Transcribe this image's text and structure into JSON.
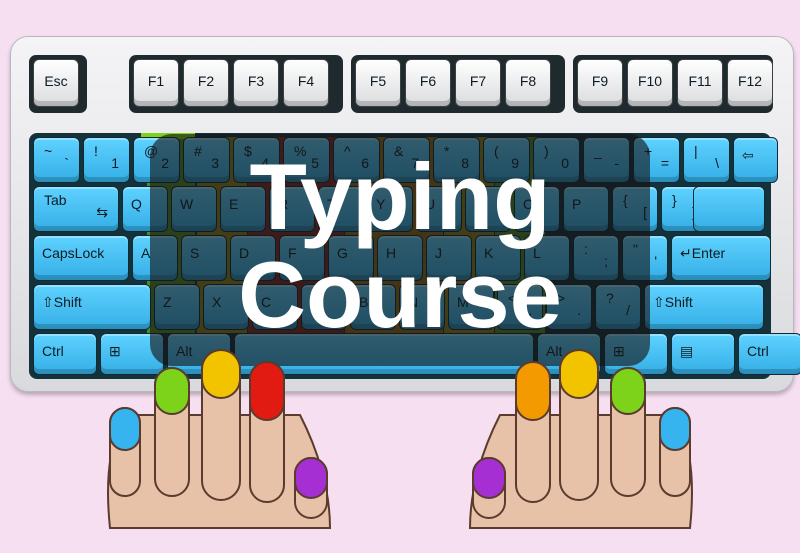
{
  "function_keys": [
    "Esc",
    "F1",
    "F2",
    "F3",
    "F4",
    "F5",
    "F6",
    "F7",
    "F8",
    "F9",
    "F10",
    "F11",
    "F12"
  ],
  "row1": [
    {
      "top": "~",
      "bottom": "`"
    },
    {
      "top": "!",
      "bottom": "1"
    },
    {
      "top": "@",
      "bottom": "2"
    },
    {
      "top": "#",
      "bottom": "3"
    },
    {
      "top": "$",
      "bottom": "4"
    },
    {
      "top": "%",
      "bottom": "5"
    },
    {
      "top": "^",
      "bottom": "6"
    },
    {
      "top": "&",
      "bottom": "7"
    },
    {
      "top": "*",
      "bottom": "8"
    },
    {
      "top": "(",
      "bottom": "9"
    },
    {
      "top": ")",
      "bottom": "0"
    },
    {
      "top": "_",
      "bottom": "-"
    },
    {
      "top": "+",
      "bottom": "="
    },
    {
      "top": "|",
      "bottom": "\\"
    },
    {
      "top": "⇦",
      "bottom": ""
    }
  ],
  "row2": [
    {
      "top": "Tab",
      "bottom": "⇆"
    },
    {
      "top": "Q",
      "bottom": ""
    },
    {
      "top": "W",
      "bottom": ""
    },
    {
      "top": "E",
      "bottom": ""
    },
    {
      "top": "R",
      "bottom": ""
    },
    {
      "top": "T",
      "bottom": ""
    },
    {
      "top": "Y",
      "bottom": ""
    },
    {
      "top": "U",
      "bottom": ""
    },
    {
      "top": "I",
      "bottom": ""
    },
    {
      "top": "O",
      "bottom": ""
    },
    {
      "top": "P",
      "bottom": ""
    },
    {
      "top": "{",
      "bottom": "["
    },
    {
      "top": "}",
      "bottom": "]"
    }
  ],
  "row3": [
    {
      "top": "CapsLock",
      "bottom": ""
    },
    {
      "top": "A",
      "bottom": ""
    },
    {
      "top": "S",
      "bottom": ""
    },
    {
      "top": "D",
      "bottom": ""
    },
    {
      "top": "F",
      "bottom": ""
    },
    {
      "top": "G",
      "bottom": ""
    },
    {
      "top": "H",
      "bottom": ""
    },
    {
      "top": "J",
      "bottom": ""
    },
    {
      "top": "K",
      "bottom": ""
    },
    {
      "top": "L",
      "bottom": ""
    },
    {
      "top": ":",
      "bottom": ";"
    },
    {
      "top": "\"",
      "bottom": "'"
    },
    {
      "top": "↵Enter",
      "bottom": ""
    }
  ],
  "row4": [
    {
      "top": "⇧Shift",
      "bottom": ""
    },
    {
      "top": "Z",
      "bottom": ""
    },
    {
      "top": "X",
      "bottom": ""
    },
    {
      "top": "C",
      "bottom": ""
    },
    {
      "top": "V",
      "bottom": ""
    },
    {
      "top": "B",
      "bottom": ""
    },
    {
      "top": "N",
      "bottom": ""
    },
    {
      "top": "M",
      "bottom": ""
    },
    {
      "top": "<",
      "bottom": ","
    },
    {
      "top": ">",
      "bottom": "."
    },
    {
      "top": "?",
      "bottom": "/"
    },
    {
      "top": "⇧Shift",
      "bottom": ""
    }
  ],
  "row5": [
    {
      "top": "Ctrl",
      "bottom": ""
    },
    {
      "top": "⊞",
      "bottom": ""
    },
    {
      "top": "Alt",
      "bottom": ""
    },
    {
      "top": "",
      "bottom": ""
    },
    {
      "top": "Alt",
      "bottom": ""
    },
    {
      "top": "⊞",
      "bottom": ""
    },
    {
      "top": "▤",
      "bottom": ""
    },
    {
      "top": "Ctrl",
      "bottom": ""
    }
  ],
  "overlay": {
    "line1": "Typing",
    "line2": "Course"
  },
  "finger_colors": {
    "pinky": "#35b4f0",
    "ring": "#7cd31a",
    "middle": "#f2c400",
    "index_left": "#e21b12",
    "index_right": "#f29a00",
    "thumb": "#a62fd3"
  }
}
